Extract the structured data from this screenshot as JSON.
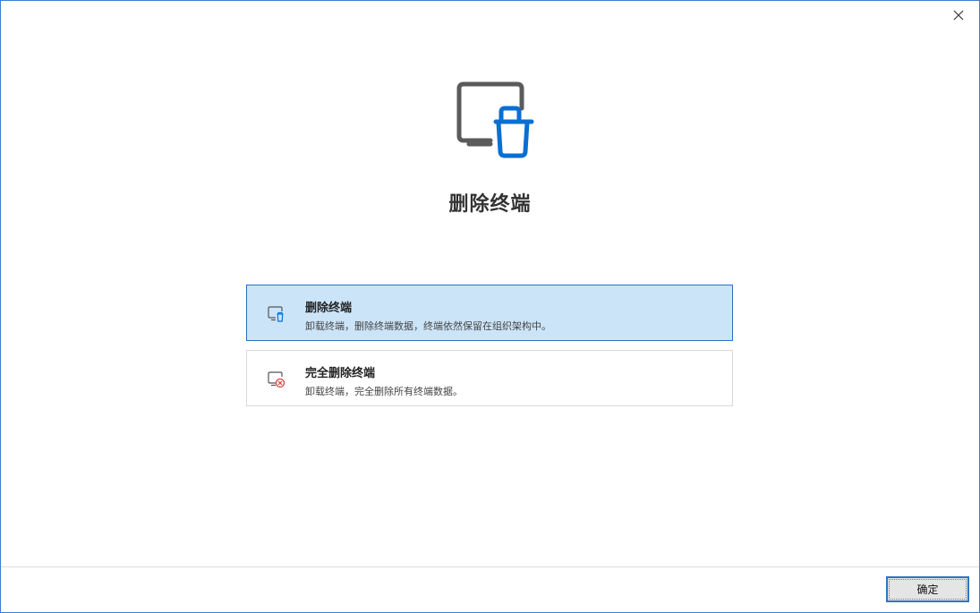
{
  "dialog": {
    "title": "删除终端"
  },
  "options": [
    {
      "title": "删除终端",
      "description": "卸载终端，删除终端数据，终端依然保留在组织架构中。",
      "icon": "monitor-trash-icon",
      "selected": true
    },
    {
      "title": "完全删除终端",
      "description": "卸载终端，完全删除所有终端数据。",
      "icon": "monitor-delete-icon",
      "selected": false
    }
  ],
  "footer": {
    "ok_label": "确定"
  },
  "colors": {
    "accent": "#0a6fd1",
    "selected_bg": "#cce4f7",
    "danger": "#d93a3a",
    "icon_gray": "#555555"
  }
}
